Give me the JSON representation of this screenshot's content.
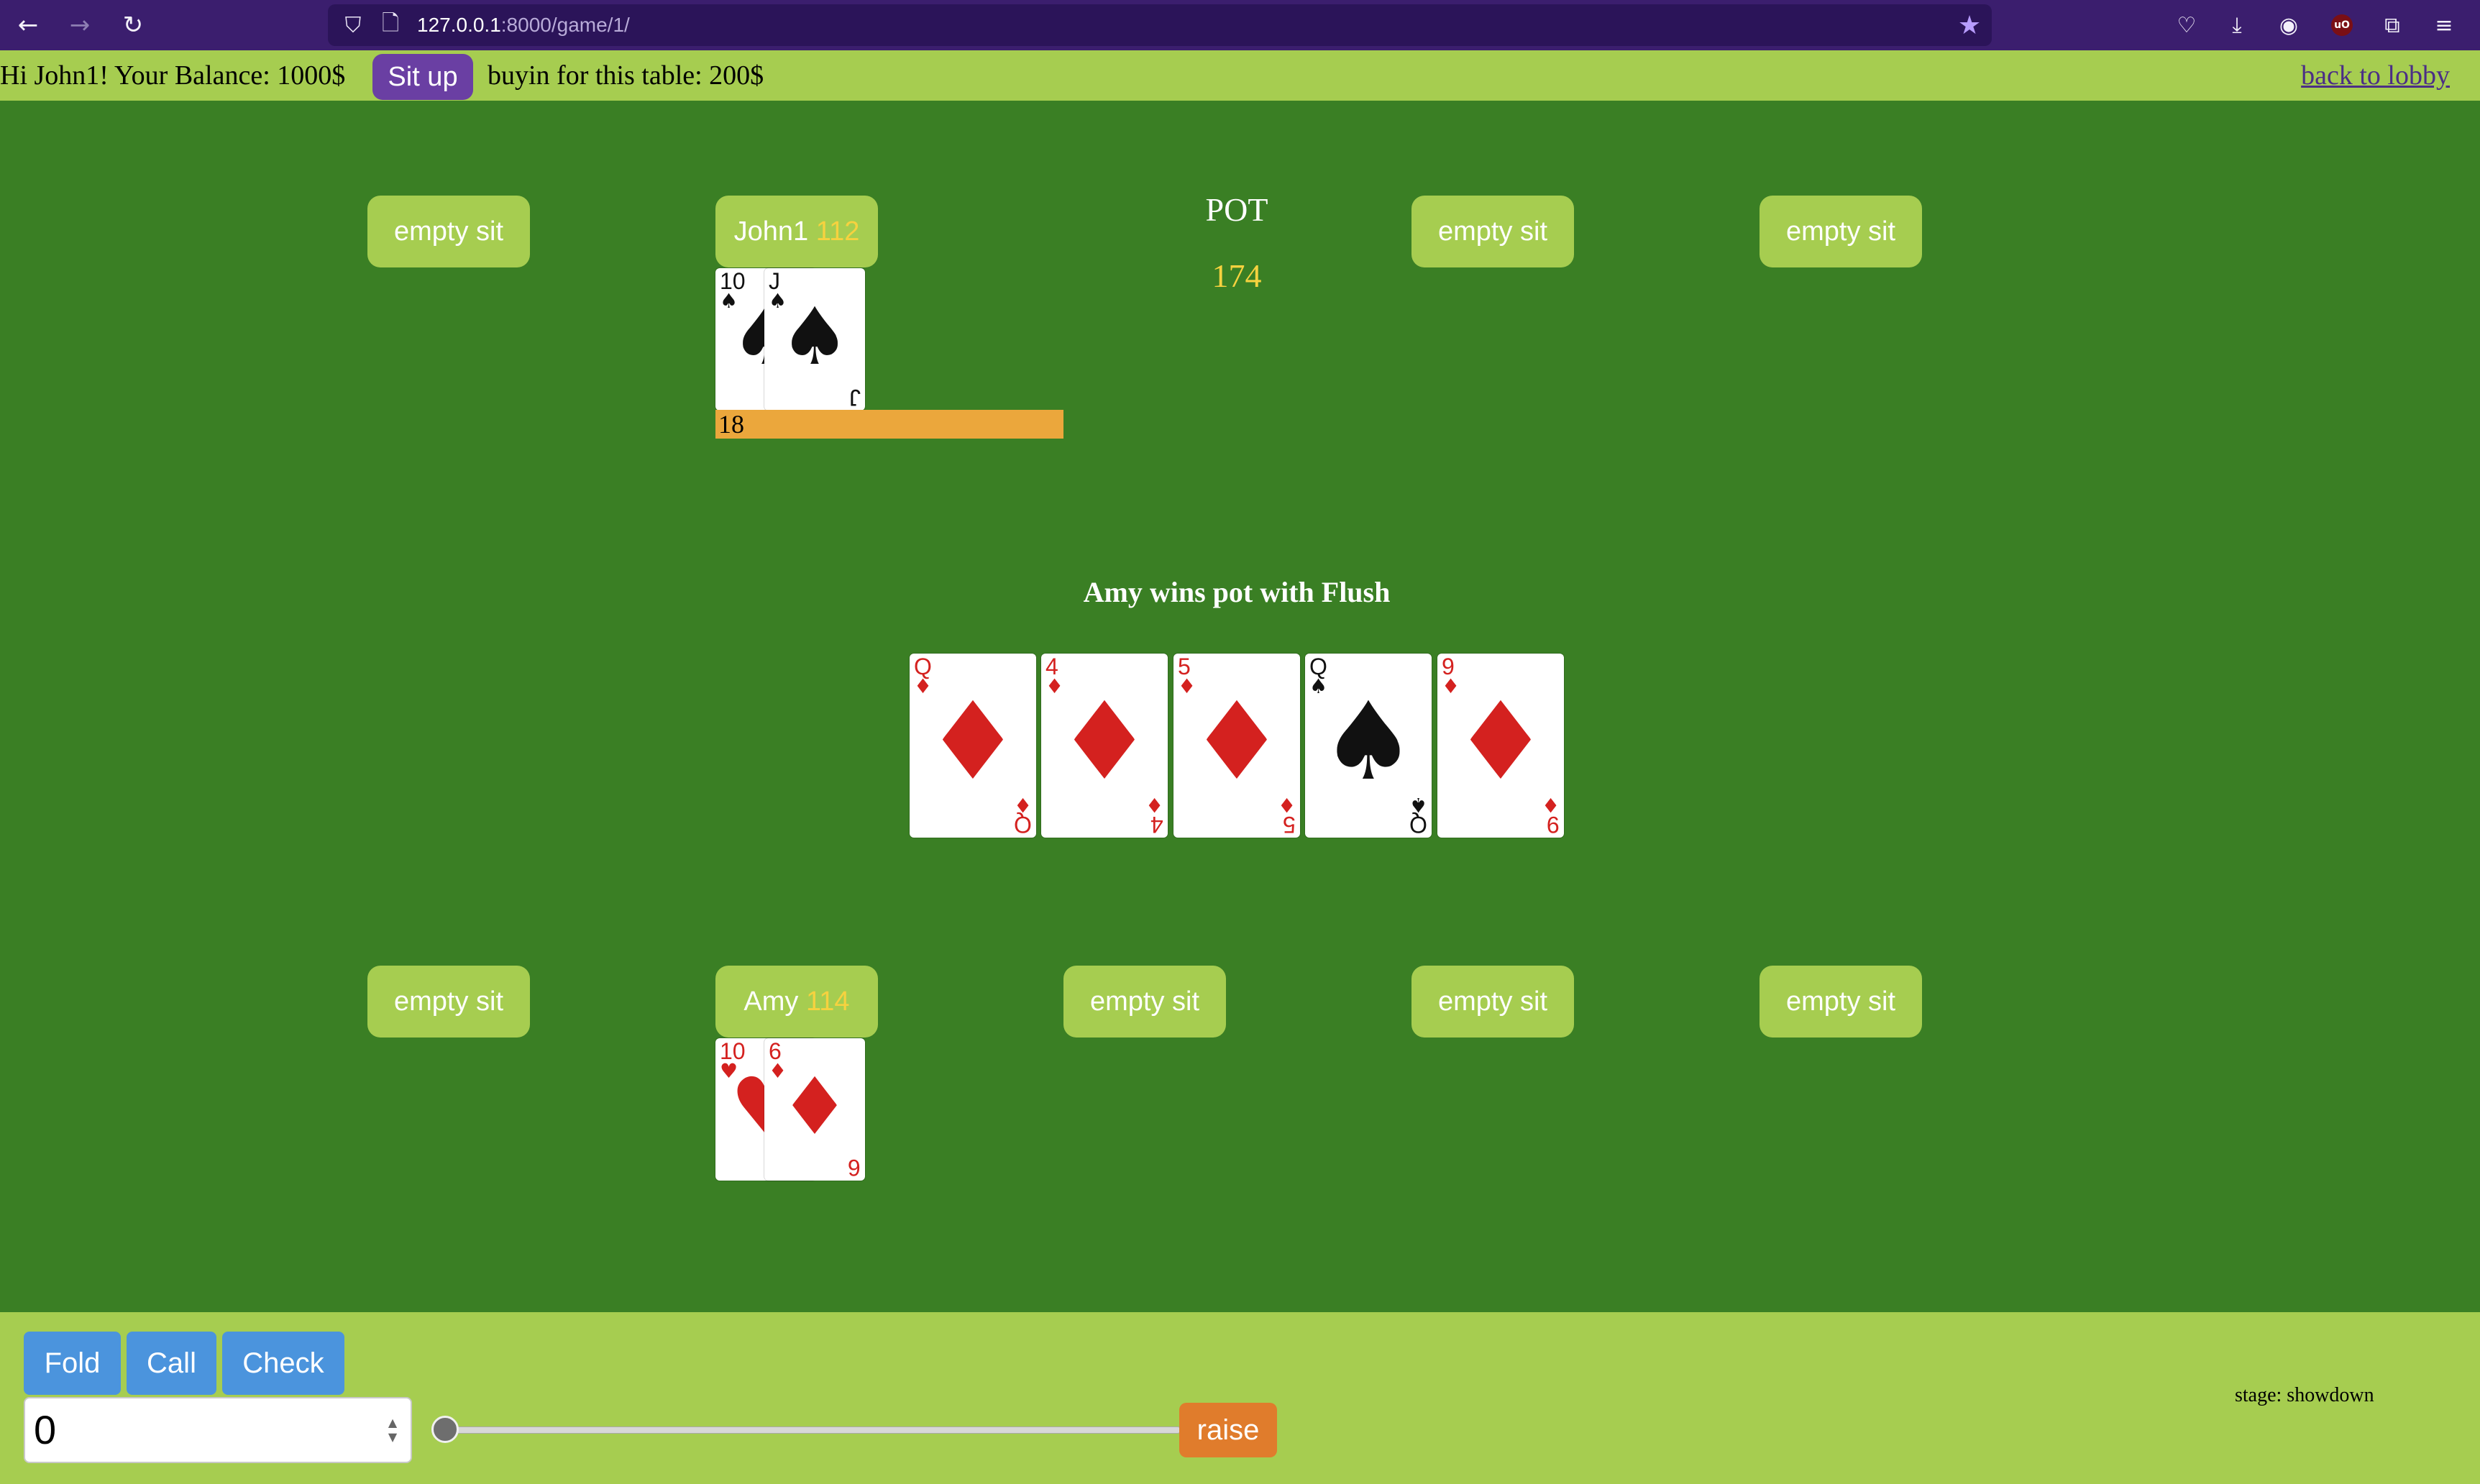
{
  "browser": {
    "url_host": "127.0.0.1",
    "url_rest": ":8000/game/1/"
  },
  "topbar": {
    "greeting": "Hi John1! Your Balance: 1000$",
    "situp_label": "Sit up",
    "buyin": "buyin for this table: 200$",
    "lobby_link": "back to lobby"
  },
  "seats": {
    "empty_label": "empty sit",
    "player1": {
      "name": "John1",
      "chips": "112"
    },
    "player2": {
      "name": "Amy",
      "chips": "114"
    }
  },
  "pot": {
    "label": "POT",
    "value": "174"
  },
  "bet": {
    "value": "18"
  },
  "result": "Amy wins pot with Flush",
  "cards": {
    "john_hand": [
      {
        "rank": "10",
        "suit": "♠",
        "color": "black"
      },
      {
        "rank": "J",
        "suit": "♠",
        "color": "black"
      }
    ],
    "amy_hand": [
      {
        "rank": "10",
        "suit": "♥",
        "color": "red"
      },
      {
        "rank": "6",
        "suit": "♦",
        "color": "red"
      }
    ],
    "board": [
      {
        "rank": "Q",
        "suit": "♦",
        "color": "red"
      },
      {
        "rank": "4",
        "suit": "♦",
        "color": "red"
      },
      {
        "rank": "5",
        "suit": "♦",
        "color": "red"
      },
      {
        "rank": "Q",
        "suit": "♠",
        "color": "black"
      },
      {
        "rank": "9",
        "suit": "♦",
        "color": "red"
      }
    ]
  },
  "controls": {
    "fold": "Fold",
    "call": "Call",
    "check": "Check",
    "amount": "0",
    "raise": "raise",
    "stage": "stage: showdown"
  },
  "colors": {
    "felt": "#3a7f24",
    "bar": "#a6cd50",
    "accent_purple": "#6a3fa3",
    "chips_yellow": "#f6d23f",
    "bet_orange": "#eba73c",
    "button_blue": "#4b94dd",
    "raise_orange": "#e07c2c"
  },
  "icons": [
    "back-icon",
    "forward-icon",
    "reload-icon",
    "shield-icon",
    "page-icon",
    "star-icon",
    "pocket-icon",
    "download-icon",
    "account-icon",
    "ublock-icon",
    "extensions-icon",
    "menu-icon"
  ]
}
